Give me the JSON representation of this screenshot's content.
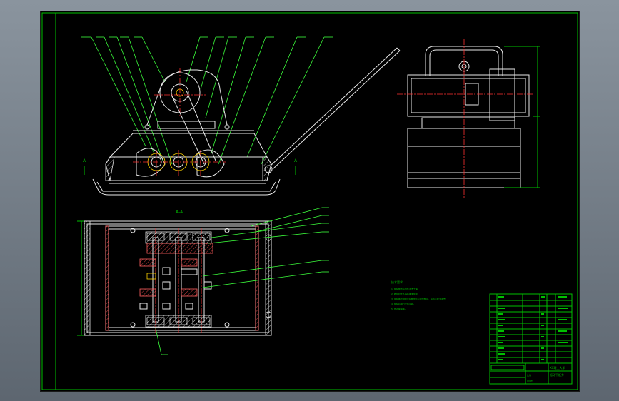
{
  "drawing": {
    "view_label": "A-A",
    "view_marker_left": "A",
    "view_marker_right": "A"
  },
  "notes": {
    "title": "技术要求",
    "lines": [
      "1. 装配前所有零件清洗干净。",
      "2. 各密封处不得有漏油现象。",
      "3. 齿轮啮合侧隙及接触斑点应符合规定，运转平稳无冲击。",
      "4. 装配后进行空载试验。",
      "5. 外表面涂漆。"
    ]
  },
  "title_block": {
    "school": "XX理工大学",
    "drawing_name": "振动平板夯",
    "scale_label": "比例",
    "sheet_label": "共1张"
  }
}
